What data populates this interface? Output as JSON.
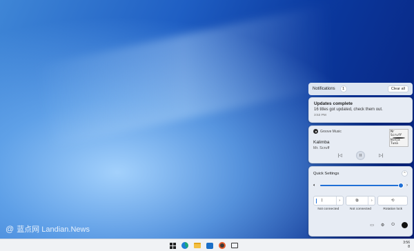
{
  "watermark": {
    "symbol": "@",
    "text": "蓝点网 Landian.News"
  },
  "notifications": {
    "header_label": "Notifications",
    "count": "1",
    "clear_all_label": "Clear all",
    "items": [
      {
        "title": "Updates complete",
        "body": "16 titles got updated, check them out.",
        "time": "3:53 PM"
      }
    ]
  },
  "media": {
    "app_name": "Groove Music",
    "track_title": "Kalimba",
    "artist": "Mr. Scruff",
    "album_art_top": "Mr Scruff",
    "album_art_bottom": "Ninja Tuna",
    "controls": {
      "prev_icon": "skip-back-icon",
      "play_icon": "pause-icon",
      "next_icon": "skip-forward-icon"
    }
  },
  "quick_settings": {
    "title": "Quick Settings",
    "volume_level": 1.0,
    "tiles": [
      {
        "label": "Not connected",
        "icon": "bluetooth-icon"
      },
      {
        "label": "Not connected",
        "icon": "cast-icon"
      },
      {
        "label": "Rotation lock",
        "icon": "rotation-lock-icon"
      }
    ]
  },
  "taskbar": {
    "apps": [
      "start-icon",
      "edge-icon",
      "file-explorer-icon",
      "mail-icon",
      "groove-icon",
      "task-view-icon"
    ],
    "time": "3:56",
    "date_line": "8"
  },
  "colors": {
    "accent": "#1f6fd6"
  }
}
